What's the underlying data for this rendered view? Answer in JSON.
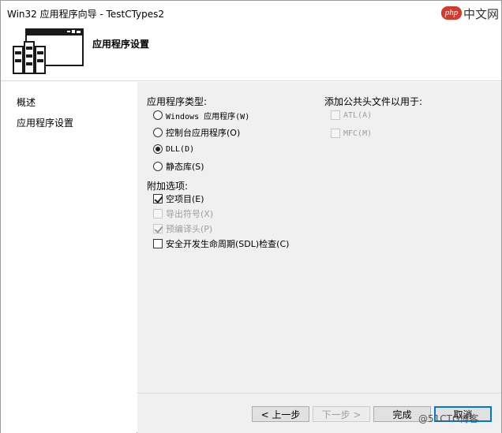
{
  "window": {
    "title": "Win32 应用程序向导 - TestCTypes2"
  },
  "watermark": {
    "php_badge": "php",
    "php_text": "中文网",
    "site_text": "@51CTO博客"
  },
  "header": {
    "heading": "应用程序设置"
  },
  "sidebar": {
    "items": [
      {
        "label": "概述"
      },
      {
        "label": "应用程序设置"
      }
    ]
  },
  "app_type": {
    "label": "应用程序类型:",
    "options": [
      {
        "label": "Windows 应用程序(W)",
        "selected": false
      },
      {
        "label": "控制台应用程序(O)",
        "selected": false
      },
      {
        "label": "DLL(D)",
        "selected": true
      },
      {
        "label": "静态库(S)",
        "selected": false
      }
    ]
  },
  "additional": {
    "label": "附加选项:",
    "options": [
      {
        "label": "空项目(E)",
        "checked": true,
        "enabled": true
      },
      {
        "label": "导出符号(X)",
        "checked": false,
        "enabled": false
      },
      {
        "label": "预编译头(P)",
        "checked": true,
        "enabled": false
      },
      {
        "label": "安全开发生命周期(SDL)检查(C)",
        "checked": false,
        "enabled": true
      }
    ]
  },
  "common_headers": {
    "label": "添加公共头文件以用于:",
    "options": [
      {
        "label": "ATL(A)",
        "checked": false,
        "enabled": false
      },
      {
        "label": "MFC(M)",
        "checked": false,
        "enabled": false
      }
    ]
  },
  "buttons": {
    "back": "< 上一步",
    "next": "下一步 >",
    "finish": "完成",
    "cancel": "取消"
  }
}
